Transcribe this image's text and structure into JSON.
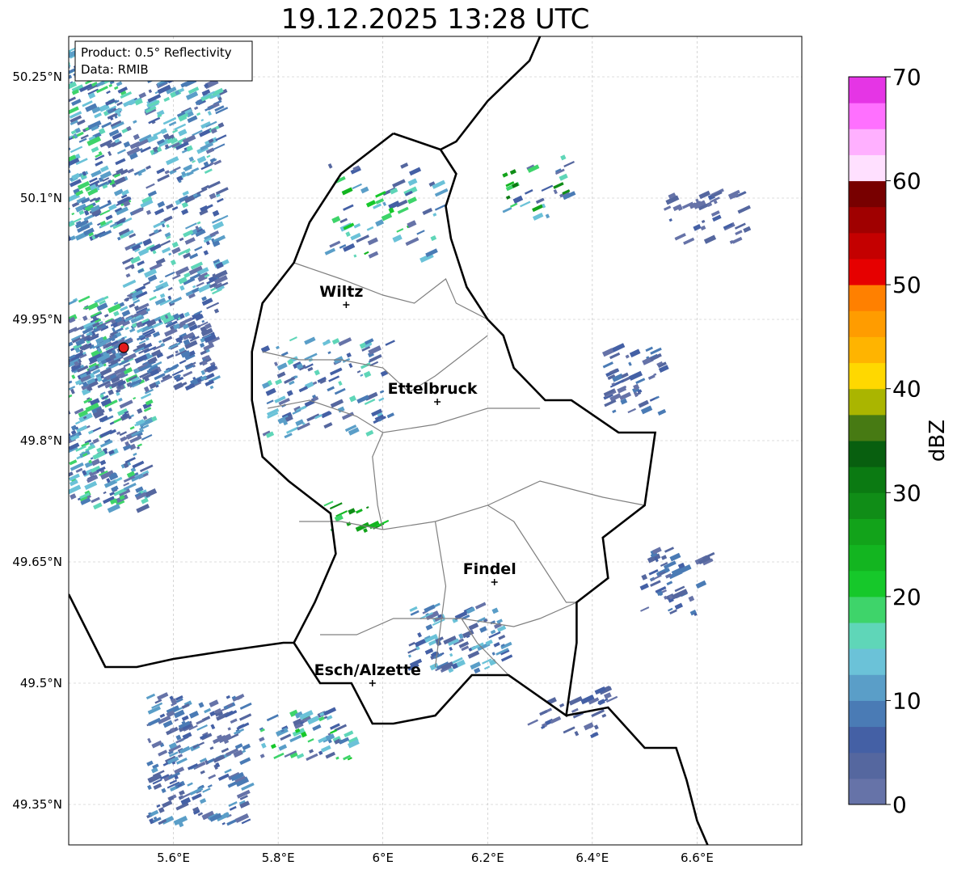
{
  "title": "19.12.2025 13:28 UTC",
  "info": {
    "product": "Product: 0.5° Reflectivity",
    "source": "Data: RMIB"
  },
  "map_extent": {
    "lon": [
      5.4,
      6.8
    ],
    "lat": [
      49.3,
      50.3
    ]
  },
  "lat_ticks": [
    {
      "v": 50.25,
      "t": "50.25°N"
    },
    {
      "v": 50.1,
      "t": "50.1°N"
    },
    {
      "v": 49.95,
      "t": "49.95°N"
    },
    {
      "v": 49.8,
      "t": "49.8°N"
    },
    {
      "v": 49.65,
      "t": "49.65°N"
    },
    {
      "v": 49.5,
      "t": "49.5°N"
    },
    {
      "v": 49.35,
      "t": "49.35°N"
    }
  ],
  "lon_ticks": [
    {
      "v": 5.6,
      "t": "5.6°E"
    },
    {
      "v": 5.8,
      "t": "5.8°E"
    },
    {
      "v": 6.0,
      "t": "6°E"
    },
    {
      "v": 6.2,
      "t": "6.2°E"
    },
    {
      "v": 6.4,
      "t": "6.4°E"
    },
    {
      "v": 6.6,
      "t": "6.6°E"
    }
  ],
  "cities": [
    {
      "name": "Wiltz",
      "lon": 5.93,
      "lat": 49.968
    },
    {
      "name": "Ettelbruck",
      "lon": 6.104,
      "lat": 49.848
    },
    {
      "name": "Findel",
      "lon": 6.213,
      "lat": 49.625
    },
    {
      "name": "Esch/Alzette",
      "lon": 5.98,
      "lat": 49.5
    }
  ],
  "radar_site": {
    "lon": 5.505,
    "lat": 49.915,
    "color": "#e41a1c"
  },
  "colorbar": {
    "label": "dBZ",
    "ticks": [
      0,
      10,
      20,
      30,
      40,
      50,
      60,
      70
    ],
    "colors": [
      "#6673a8",
      "#55679f",
      "#4460a5",
      "#4a7bb5",
      "#5a9ec8",
      "#6bc2d8",
      "#5fd6b8",
      "#3ed46a",
      "#16c82a",
      "#13b520",
      "#12a31a",
      "#108d17",
      "#0b7a12",
      "#085f0f",
      "#477a13",
      "#aab500",
      "#ffd800",
      "#ffb400",
      "#ff9c00",
      "#ff8000",
      "#e60000",
      "#c40000",
      "#a00000",
      "#780000",
      "#ffe0ff",
      "#ffb0ff",
      "#ff70ff",
      "#e535e5"
    ]
  },
  "luxembourg_border": [
    [
      6.02,
      50.18
    ],
    [
      6.11,
      50.16
    ],
    [
      6.14,
      50.13
    ],
    [
      6.12,
      50.09
    ],
    [
      6.13,
      50.05
    ],
    [
      6.16,
      49.99
    ],
    [
      6.2,
      49.95
    ],
    [
      6.23,
      49.93
    ],
    [
      6.25,
      49.89
    ],
    [
      6.31,
      49.85
    ],
    [
      6.36,
      49.85
    ],
    [
      6.45,
      49.81
    ],
    [
      6.52,
      49.81
    ],
    [
      6.5,
      49.72
    ],
    [
      6.42,
      49.68
    ],
    [
      6.43,
      49.63
    ],
    [
      6.37,
      49.6
    ],
    [
      6.37,
      49.55
    ],
    [
      6.35,
      49.46
    ],
    [
      6.24,
      49.51
    ],
    [
      6.17,
      49.51
    ],
    [
      6.1,
      49.46
    ],
    [
      6.02,
      49.45
    ],
    [
      5.98,
      49.45
    ],
    [
      5.94,
      49.5
    ],
    [
      5.88,
      49.5
    ],
    [
      5.83,
      49.55
    ],
    [
      5.87,
      49.6
    ],
    [
      5.91,
      49.66
    ],
    [
      5.9,
      49.71
    ],
    [
      5.82,
      49.75
    ],
    [
      5.77,
      49.78
    ],
    [
      5.75,
      49.85
    ],
    [
      5.75,
      49.91
    ],
    [
      5.77,
      49.97
    ],
    [
      5.83,
      50.02
    ],
    [
      5.86,
      50.07
    ],
    [
      5.92,
      50.13
    ],
    [
      6.02,
      50.18
    ]
  ],
  "germany_border": [
    [
      6.3,
      50.3
    ],
    [
      6.28,
      50.27
    ],
    [
      6.2,
      50.22
    ],
    [
      6.14,
      50.17
    ],
    [
      6.11,
      50.16
    ]
  ],
  "france_border": [
    [
      5.4,
      49.61
    ],
    [
      5.47,
      49.52
    ],
    [
      5.53,
      49.52
    ],
    [
      5.6,
      49.53
    ],
    [
      5.7,
      49.54
    ],
    [
      5.81,
      49.55
    ],
    [
      5.83,
      49.55
    ]
  ],
  "east_border": [
    [
      6.35,
      49.46
    ],
    [
      6.43,
      49.47
    ],
    [
      6.5,
      49.42
    ],
    [
      6.56,
      49.42
    ],
    [
      6.58,
      49.38
    ],
    [
      6.6,
      49.33
    ],
    [
      6.62,
      49.3
    ]
  ],
  "cantons": [
    [
      [
        5.83,
        50.02
      ],
      [
        5.92,
        50.0
      ],
      [
        6.0,
        49.98
      ],
      [
        6.06,
        49.97
      ],
      [
        6.12,
        50.0
      ],
      [
        6.14,
        49.97
      ],
      [
        6.2,
        49.95
      ]
    ],
    [
      [
        5.77,
        49.91
      ],
      [
        5.84,
        49.9
      ],
      [
        5.92,
        49.9
      ],
      [
        6.0,
        49.89
      ],
      [
        6.05,
        49.86
      ],
      [
        6.1,
        49.88
      ],
      [
        6.2,
        49.93
      ]
    ],
    [
      [
        5.78,
        49.84
      ],
      [
        5.86,
        49.85
      ],
      [
        5.95,
        49.83
      ],
      [
        6.0,
        49.81
      ],
      [
        6.1,
        49.82
      ],
      [
        6.2,
        49.84
      ],
      [
        6.3,
        49.84
      ]
    ],
    [
      [
        6.0,
        49.81
      ],
      [
        5.98,
        49.78
      ],
      [
        5.99,
        49.72
      ],
      [
        6.0,
        49.69
      ]
    ],
    [
      [
        5.84,
        49.7
      ],
      [
        5.92,
        49.7
      ],
      [
        6.0,
        49.69
      ],
      [
        6.1,
        49.7
      ],
      [
        6.2,
        49.72
      ],
      [
        6.3,
        49.75
      ],
      [
        6.42,
        49.73
      ],
      [
        6.5,
        49.72
      ]
    ],
    [
      [
        6.1,
        49.7
      ],
      [
        6.12,
        49.62
      ],
      [
        6.11,
        49.57
      ],
      [
        6.1,
        49.52
      ]
    ],
    [
      [
        5.88,
        49.56
      ],
      [
        5.95,
        49.56
      ],
      [
        6.02,
        49.58
      ],
      [
        6.08,
        49.58
      ],
      [
        6.15,
        49.58
      ],
      [
        6.25,
        49.57
      ],
      [
        6.3,
        49.58
      ],
      [
        6.37,
        49.6
      ]
    ],
    [
      [
        6.15,
        49.58
      ],
      [
        6.18,
        49.55
      ],
      [
        6.24,
        49.51
      ]
    ],
    [
      [
        6.2,
        49.72
      ],
      [
        6.25,
        49.7
      ],
      [
        6.3,
        49.65
      ],
      [
        6.35,
        49.6
      ],
      [
        6.37,
        49.6
      ]
    ]
  ]
}
